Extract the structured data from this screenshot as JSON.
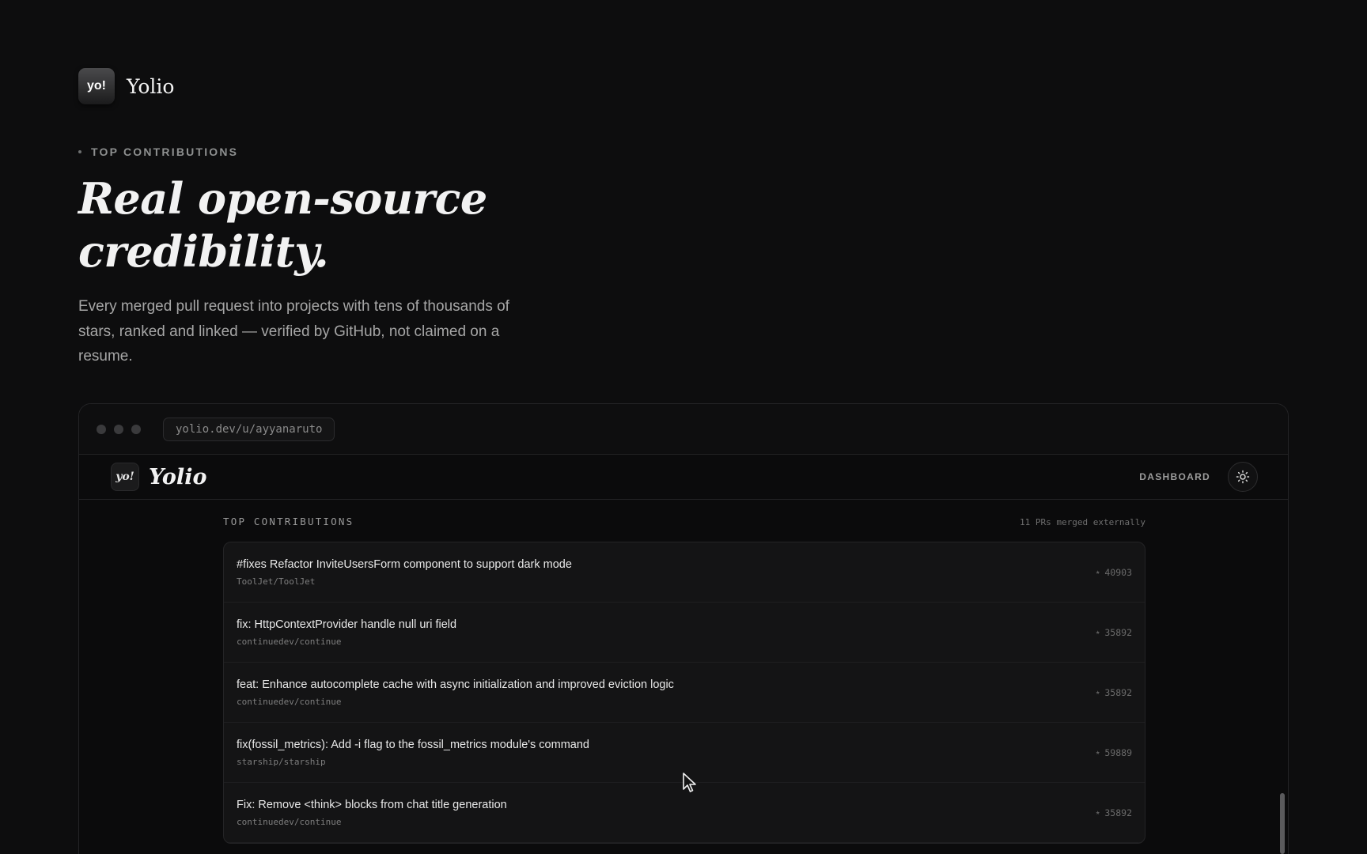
{
  "site": {
    "logo_text": "yo!",
    "brand": "Yolio"
  },
  "hero": {
    "eyebrow": "TOP CONTRIBUTIONS",
    "title_line1": "Real open-source",
    "title_line2": "credibility.",
    "subtitle": "Every merged pull request into projects with tens of thousands of stars, ranked and linked — verified by GitHub, not claimed on a resume."
  },
  "browser": {
    "url": "yolio.dev/u/ayyanaruto"
  },
  "app": {
    "logo_text": "yo!",
    "brand": "Yolio",
    "nav_dashboard": "DASHBOARD",
    "theme_icon": "sun-icon"
  },
  "contributions": {
    "label": "TOP CONTRIBUTIONS",
    "meta": "11 PRs merged externally",
    "items": [
      {
        "title": "#fixes Refactor InviteUsersForm component to support dark mode",
        "repo": "ToolJet/ToolJet",
        "stars": "40903"
      },
      {
        "title": "fix: HttpContextProvider handle null uri field",
        "repo": "continuedev/continue",
        "stars": "35892"
      },
      {
        "title": "feat: Enhance autocomplete cache with async initialization and improved eviction logic",
        "repo": "continuedev/continue",
        "stars": "35892"
      },
      {
        "title": "fix(fossil_metrics): Add -i flag to the fossil_metrics module's command",
        "repo": "starship/starship",
        "stars": "59889"
      },
      {
        "title": "Fix: Remove <think> blocks from chat title generation",
        "repo": "continuedev/continue",
        "stars": "35892"
      }
    ]
  },
  "colors": {
    "background": "#0d0d0e",
    "card": "#141415",
    "text_primary": "#e9e9e9",
    "text_muted": "#7e7e7e"
  }
}
